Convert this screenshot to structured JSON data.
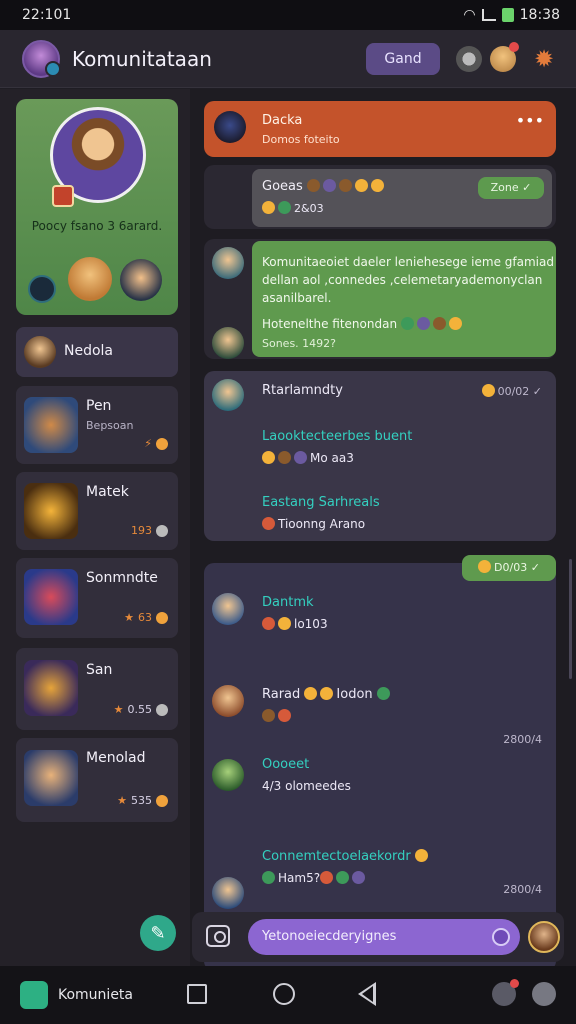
{
  "status": {
    "time": "22:101",
    "clock": "18:38"
  },
  "header": {
    "title": "Komunitataan",
    "action_label": "Gand"
  },
  "sidebar": {
    "feature": {
      "text": "Poocy fsano 3 6arard."
    },
    "items": [
      {
        "name": "Nedola",
        "sub": "",
        "meta": ""
      },
      {
        "name": "Pen",
        "sub": "Bepsoan",
        "meta": ""
      },
      {
        "name": "Matek",
        "sub": "",
        "meta": "193"
      },
      {
        "name": "Sonmndte",
        "sub": "",
        "meta": "63"
      },
      {
        "name": "San",
        "sub": "",
        "meta": "0.55"
      },
      {
        "name": "Menolad",
        "sub": "",
        "meta": "535"
      }
    ]
  },
  "chat": {
    "pinned": {
      "title": "Dacka",
      "sub": "Domos foteito"
    },
    "goeas": {
      "text": "Goeas",
      "sub": "2&03",
      "done": "Zone"
    },
    "announce": {
      "line1": "Komunitaeoiet daeler leniehesege ieme gfamiad",
      "line2": "dellan aol ,connedes ,celemetaryademonyclan",
      "line3": "asanilbarel.",
      "line4": "Hotenelthe fitenondan",
      "line5": "Sones. 1492?"
    },
    "thread1": {
      "name": "Rtarlamndty",
      "time": "00/02",
      "msg1": "Laooktecteerbes buent",
      "msg1_sub": "Mo aa3",
      "msg2": "Eastang Sarhreals",
      "msg2_sub": "Tioonng Arano"
    },
    "thread2": {
      "tag": "D0/03",
      "m1_name": "Dantmk",
      "m1_sub": "lo103",
      "m2_name": "Rarad",
      "m2_text": "Iodon",
      "m2_time": "2800/4",
      "m3_name": "Oooeet",
      "m3_text": "4/3  olomeedes",
      "m4_name": "Connemtectoelaekordr",
      "m4_text": "Ham5?",
      "m4_time": "2800/4"
    }
  },
  "composer": {
    "placeholder": "Yetonoeiecderyignes"
  },
  "navbar": {
    "app_label": "Komunieta"
  },
  "colors": {
    "accent": "#8c66d1",
    "green": "#5f9a4e",
    "orange": "#c4532b"
  }
}
